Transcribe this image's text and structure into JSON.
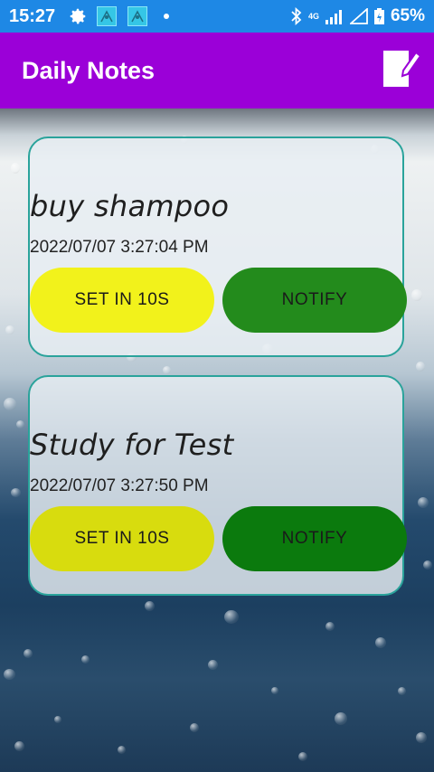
{
  "status_bar": {
    "time": "15:27",
    "network": "4G",
    "battery": "65%"
  },
  "app_bar": {
    "title": "Daily Notes",
    "action_icon": "edit-note-icon"
  },
  "colors": {
    "status_bar": "#1e88e5",
    "app_bar": "#9b00d8",
    "card_border": "#2aa39b",
    "set_button": "#f2f21b",
    "notify_button": "#238b1c"
  },
  "notes": [
    {
      "title": "buy shampoo",
      "datetime": "2022/07/07 3:27:04 PM",
      "set_label": "SET IN 10S",
      "notify_label": "NOTIFY"
    },
    {
      "title": "Study for Test",
      "datetime": "2022/07/07 3:27:50 PM",
      "set_label": "SET IN 10S",
      "notify_label": "NOTIFY"
    }
  ]
}
